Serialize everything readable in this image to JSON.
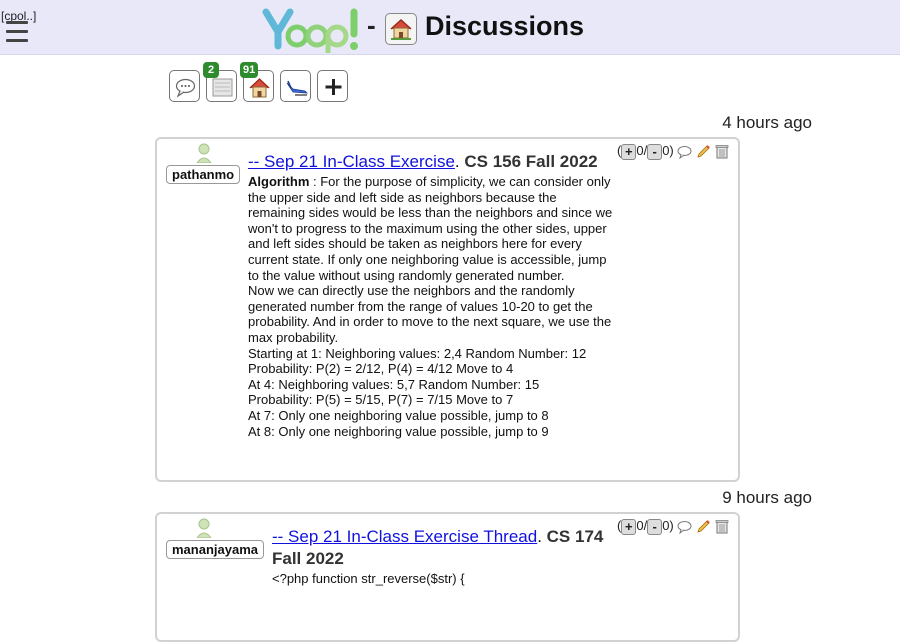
{
  "header": {
    "menu_label": "[cpol..]",
    "logo_text": "Yoop!",
    "separator": "-",
    "title": "Discussions"
  },
  "toolbar": {
    "items": [
      {
        "icon": "speech-bubble-icon",
        "badge": ""
      },
      {
        "icon": "notes-icon",
        "badge": "2"
      },
      {
        "icon": "home-icon",
        "badge": "91"
      },
      {
        "icon": "airplane-icon",
        "badge": ""
      },
      {
        "icon": "plus-icon",
        "badge": ""
      }
    ]
  },
  "posts": [
    {
      "timestamp": "4 hours ago",
      "user": "pathanmo",
      "link_text": "-- Sep 21 In-Class Exercise",
      "separator": ".",
      "course": "CS 156 Fall 2022",
      "votes": {
        "open": "(",
        "up": "+",
        "up_count": "0/",
        "down": "-",
        "down_count": "0",
        "close": ")"
      },
      "algo_label": "Algorithm",
      "lines": [
        ": For the purpose of simplicity, we can consider only the upper side and left side as neighbors because the remaining sides would be less than the neighbors and since we won't to progress to the maximum using the other sides, upper and left sides should be taken as neighbors here for every current state. If only one neighboring value is accessible, jump to the value without using randomly generated number.",
        "Now we can directly use the neighbors and the randomly generated number from the range of values 10-20 to get the probability. And in order to move to the next square, we use the max probability.",
        "Starting at 1: Neighboring values: 2,4 Random Number: 12",
        "Probability: P(2) = 2/12, P(4) = 4/12 Move to 4",
        "At 4: Neighboring values: 5,7 Random Number: 15",
        "Probability: P(5) = 5/15, P(7) = 7/15 Move to 7",
        "At 7: Only one neighboring value possible, jump to 8",
        "At 8: Only one neighboring value possible, jump to 9"
      ]
    },
    {
      "timestamp": "9 hours ago",
      "user": "mananjayama",
      "link_text": "-- Sep 21 In-Class Exercise Thread",
      "separator": ".",
      "course": "CS 174 Fall 2022",
      "votes": {
        "open": "(",
        "up": "+",
        "up_count": "0/",
        "down": "-",
        "down_count": "0",
        "close": ")"
      },
      "lines": [
        "<?php function str_reverse($str) {"
      ]
    }
  ],
  "colors": {
    "header_bg": "#e8e8f8",
    "link": "#1111dd",
    "badge": "#2e8b2e"
  }
}
